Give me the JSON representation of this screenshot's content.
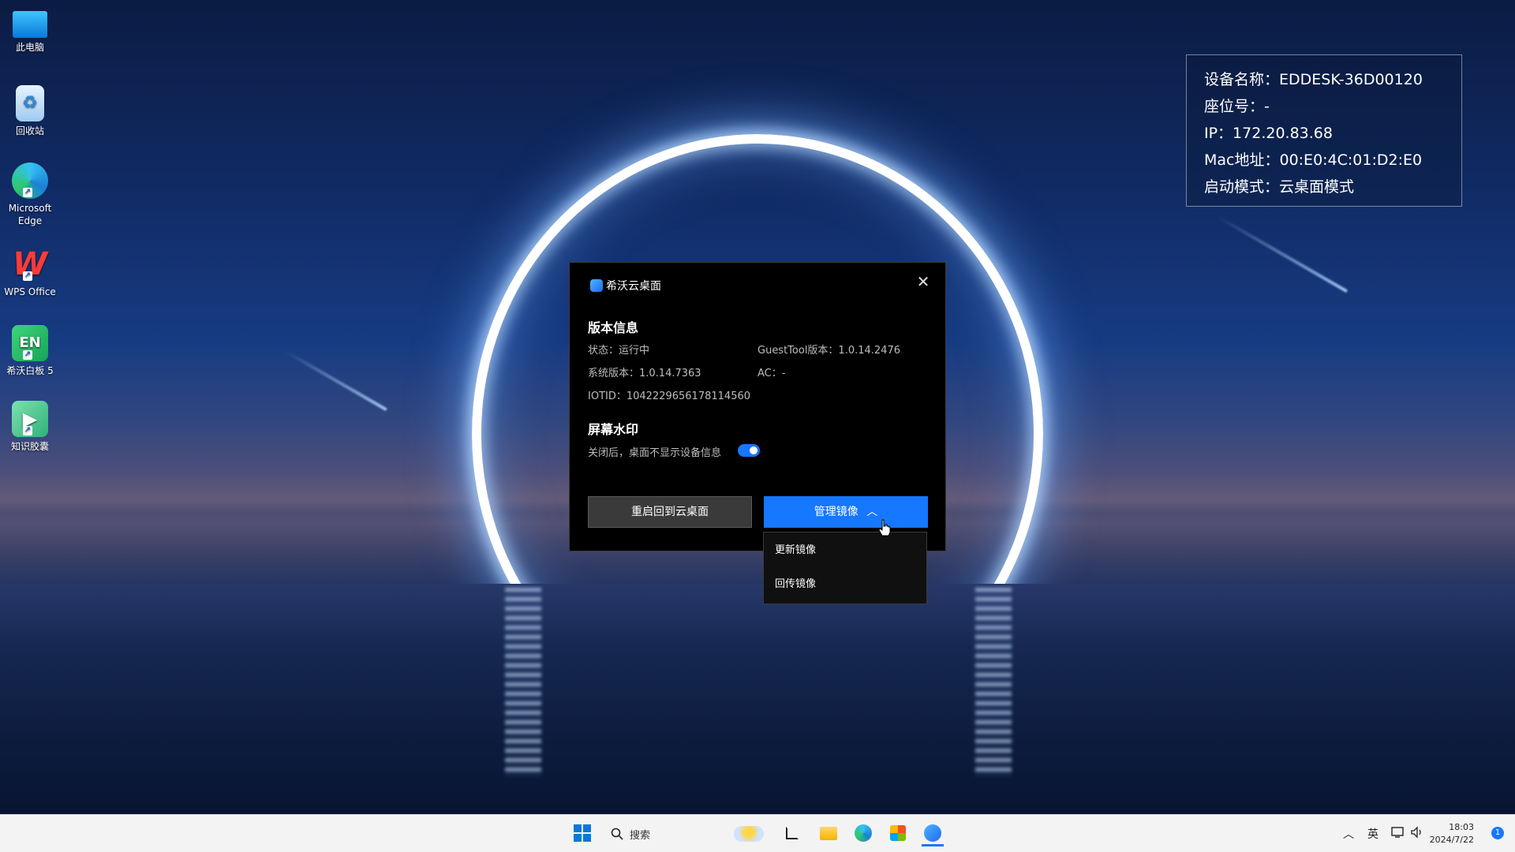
{
  "desktop": {
    "icons": [
      {
        "label": "此电脑",
        "icon": "computer-icon"
      },
      {
        "label": "回收站",
        "icon": "recycle-bin-icon"
      },
      {
        "label": "Microsoft Edge",
        "icon": "edge-icon"
      },
      {
        "label": "WPS Office",
        "icon": "wps-icon"
      },
      {
        "label": "希沃白板 5",
        "icon": "seewo-whiteboard-icon",
        "glyph": "EN"
      },
      {
        "label": "知识胶囊",
        "icon": "knowledge-capsule-icon"
      }
    ]
  },
  "info_panel": {
    "device_name": "设备名称：EDDESK-36D00120",
    "seat_no": "座位号：-",
    "ip": "IP：172.20.83.68",
    "mac": "Mac地址：00:E0:4C:01:D2:E0",
    "boot_mode": "启动模式：云桌面模式"
  },
  "dialog": {
    "title": "希沃云桌面",
    "close_glyph": "✕",
    "version_heading": "版本信息",
    "status": "状态：运行中",
    "guesttool_version": "GuestTool版本：1.0.14.2476",
    "system_version": "系统版本：1.0.14.7363",
    "ac": "AC：-",
    "iotid": "IOTID：1042229656178114560",
    "watermark_heading": "屏幕水印",
    "watermark_desc": "关闭后，桌面不显示设备信息",
    "watermark_enabled": true,
    "restart_button": "重启回到云桌面",
    "manage_button": "管理镜像",
    "manage_chevron": "︿"
  },
  "dropdown": {
    "items": [
      "更新镜像",
      "回传镜像"
    ]
  },
  "taskbar": {
    "search_placeholder": "搜索",
    "ime": "英",
    "time": "18:03",
    "date": "2024/7/22",
    "notification_count": "1",
    "tray_chevron": "︿"
  },
  "colors": {
    "accent": "#1677ff",
    "dialog_bg": "#000000",
    "taskbar_bg": "#f3f3f3"
  }
}
